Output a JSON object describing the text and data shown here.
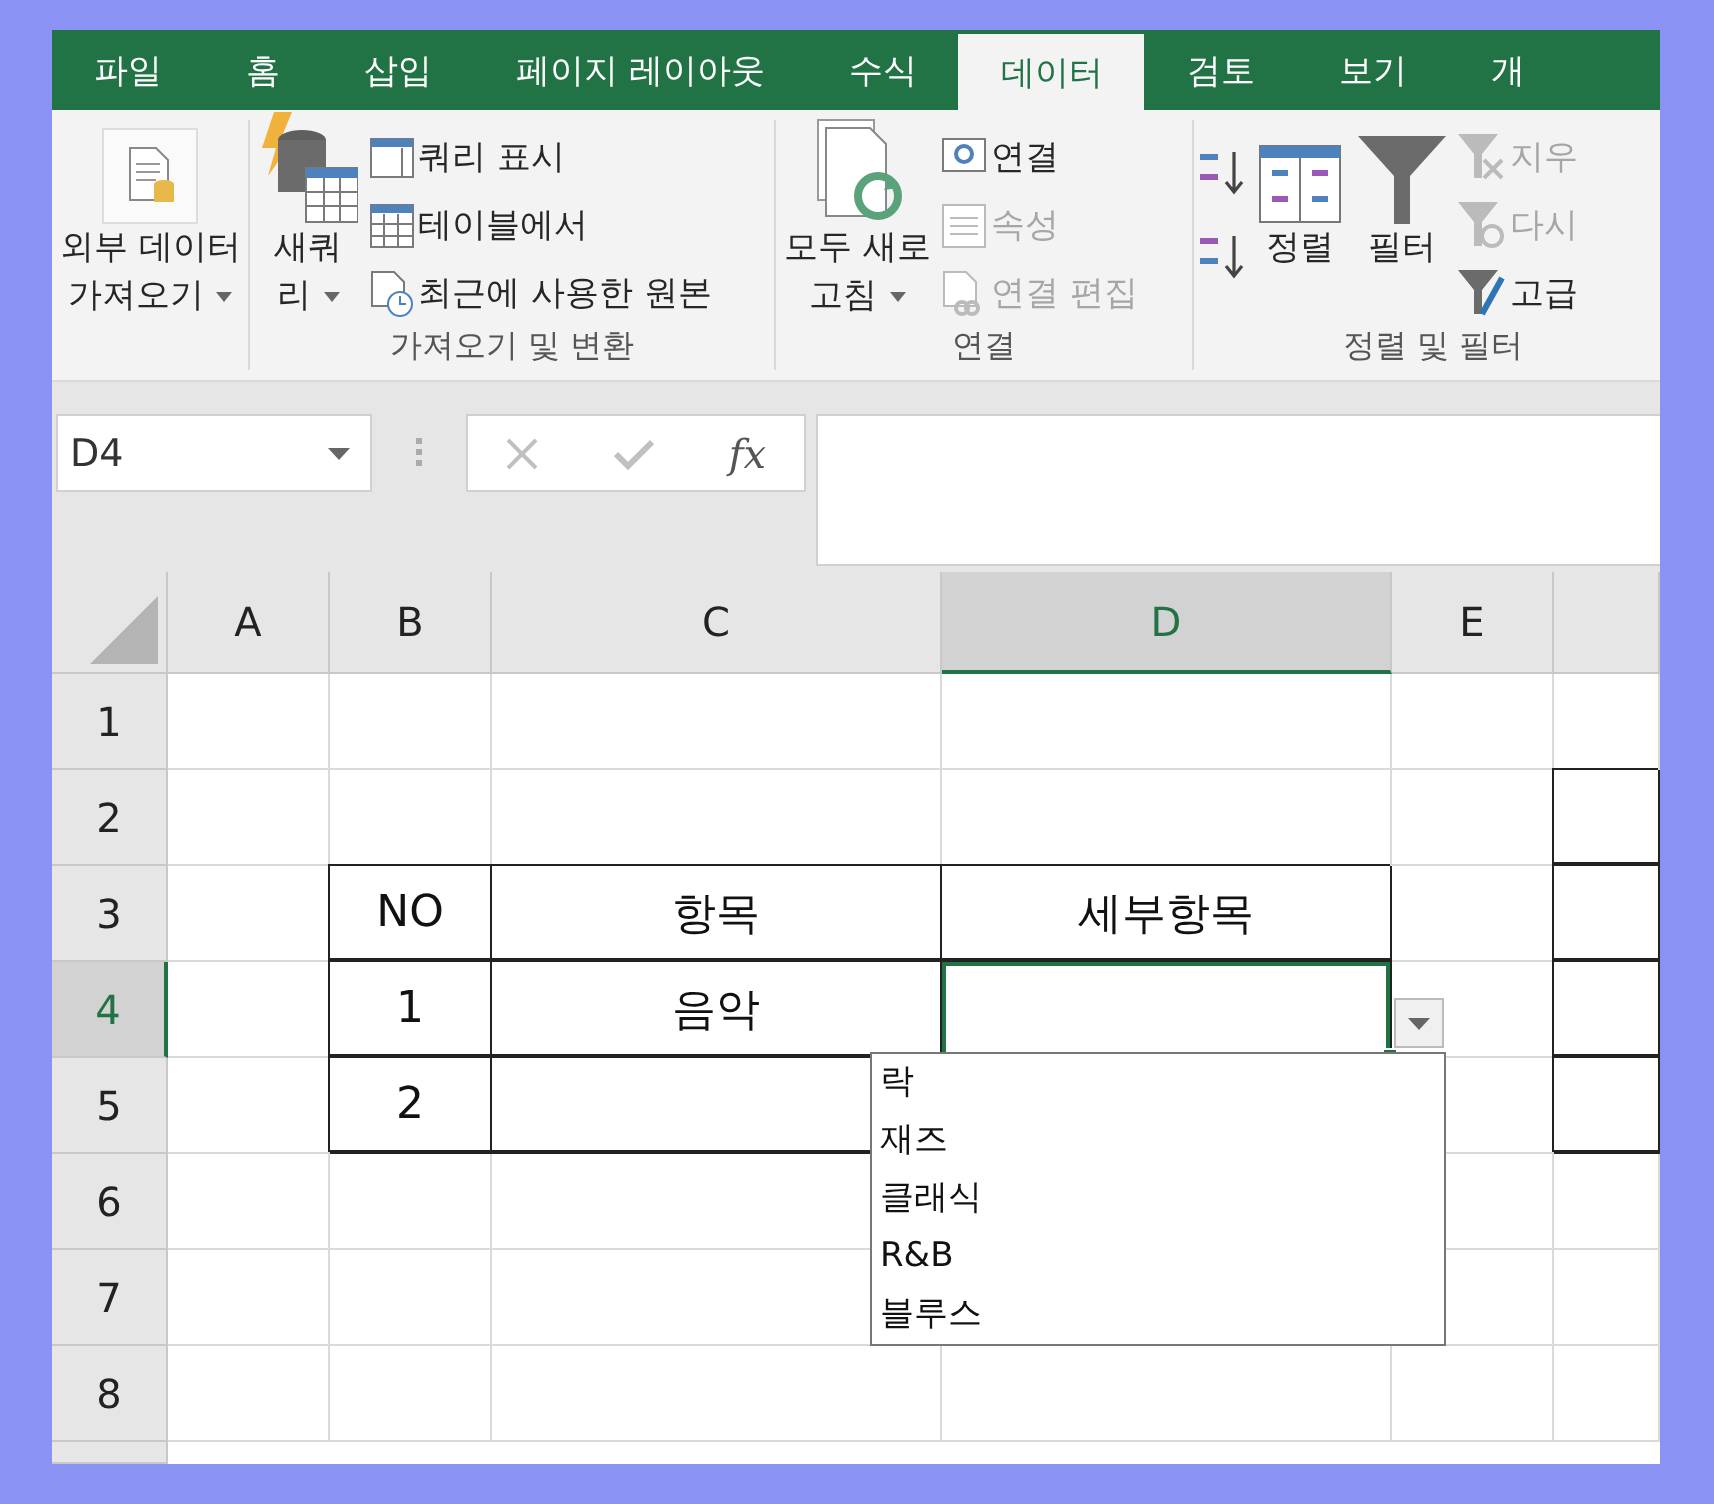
{
  "tabs": [
    {
      "label": "파일",
      "selected": false
    },
    {
      "label": "홈",
      "selected": false
    },
    {
      "label": "삽입",
      "selected": false
    },
    {
      "label": "페이지 레이아웃",
      "selected": false
    },
    {
      "label": "수식",
      "selected": false
    },
    {
      "label": "데이터",
      "selected": true
    },
    {
      "label": "검토",
      "selected": false
    },
    {
      "label": "보기",
      "selected": false
    },
    {
      "label": "개",
      "selected": false
    }
  ],
  "ribbon": {
    "groups": [
      {
        "columns": [
          {
            "kind": "big",
            "lines": [
              "외부 데이터",
              "가져오기"
            ],
            "caret": true
          }
        ]
      },
      {
        "label": "가져오기 및 변환",
        "columns": [
          {
            "kind": "big",
            "lines": [
              "새쿼",
              "리"
            ],
            "caret": true
          },
          {
            "kind": "stack",
            "items": [
              {
                "label": "쿼리 표시",
                "disabled": false
              },
              {
                "label": "테이블에서",
                "disabled": false
              },
              {
                "label": "최근에 사용한 원본",
                "disabled": false
              }
            ]
          }
        ]
      },
      {
        "label": "연결",
        "columns": [
          {
            "kind": "big",
            "lines": [
              "모두 새로",
              "고침"
            ],
            "caret": true
          },
          {
            "kind": "stack",
            "items": [
              {
                "label": "연결",
                "disabled": false
              },
              {
                "label": "속성",
                "disabled": true
              },
              {
                "label": "연결 편집",
                "disabled": true
              }
            ]
          }
        ]
      },
      {
        "label": "정렬 및 필터",
        "columns": [
          {
            "kind": "sort"
          },
          {
            "kind": "big",
            "lines": [
              "정렬"
            ],
            "caret": false
          },
          {
            "kind": "big",
            "lines": [
              "필터"
            ],
            "caret": false
          },
          {
            "kind": "stack",
            "items": [
              {
                "label": "지우",
                "disabled": true
              },
              {
                "label": "다시",
                "disabled": true
              },
              {
                "label": "고급",
                "disabled": false
              }
            ]
          }
        ]
      }
    ]
  },
  "formula_bar": {
    "name_box": "D4",
    "fx": "fx"
  },
  "sheet": {
    "columns": [
      {
        "label": "A",
        "selected": false
      },
      {
        "label": "B",
        "selected": false
      },
      {
        "label": "C",
        "selected": false
      },
      {
        "label": "D",
        "selected": true
      },
      {
        "label": "E",
        "selected": false
      }
    ],
    "rows": [
      {
        "label": "1",
        "selected": false,
        "cells": [
          {
            "bordered": false
          },
          {
            "bordered": false
          },
          {
            "bordered": false
          },
          {
            "bordered": false
          },
          {
            "bordered": false
          },
          {
            "bordered": false
          }
        ]
      },
      {
        "label": "2",
        "selected": false,
        "cells": [
          {
            "bordered": false
          },
          {
            "bordered": false
          },
          {
            "bordered": false
          },
          {
            "bordered": false
          },
          {
            "bordered": false
          },
          {
            "bordered": true
          }
        ]
      },
      {
        "label": "3",
        "selected": false,
        "cells": [
          {
            "bordered": false
          },
          {
            "text": "NO",
            "bordered": true
          },
          {
            "text": "항목",
            "bordered": true
          },
          {
            "text": "세부항목",
            "bordered": true
          },
          {
            "bordered": false
          },
          {
            "bordered": true
          }
        ]
      },
      {
        "label": "4",
        "selected": true,
        "cells": [
          {
            "bordered": false
          },
          {
            "text": "1",
            "bordered": true
          },
          {
            "text": "음악",
            "bordered": true
          },
          {
            "bordered": true
          },
          {
            "bordered": false
          },
          {
            "bordered": true
          }
        ]
      },
      {
        "label": "5",
        "selected": false,
        "cells": [
          {
            "bordered": false
          },
          {
            "text": "2",
            "bordered": true
          },
          {
            "bordered": true
          },
          null,
          {
            "bordered": false
          },
          {
            "bordered": true
          }
        ]
      },
      {
        "label": "6",
        "selected": false,
        "cells": [
          {
            "bordered": false
          },
          {
            "bordered": false
          },
          {
            "bordered": false
          },
          null,
          {
            "bordered": false
          },
          {
            "bordered": false
          }
        ]
      },
      {
        "label": "7",
        "selected": false,
        "cells": [
          {
            "bordered": false
          },
          {
            "bordered": false
          },
          {
            "bordered": false
          },
          null,
          {
            "bordered": false
          },
          {
            "bordered": false
          }
        ]
      },
      {
        "label": "8",
        "selected": false,
        "cells": [
          {
            "bordered": false
          },
          {
            "bordered": false
          },
          {
            "bordered": false
          },
          {
            "bordered": false
          },
          {
            "bordered": false
          },
          {
            "bordered": false
          }
        ]
      }
    ]
  },
  "dropdown": {
    "items": [
      "락",
      "재즈",
      "클래식",
      "R&B",
      "블루스"
    ]
  }
}
